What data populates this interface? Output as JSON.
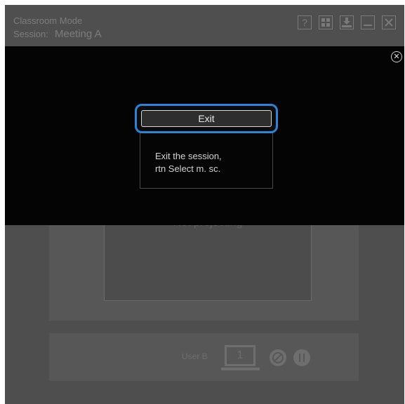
{
  "titlebar": {
    "mode": "Classroom Mode",
    "session_label": "Session:",
    "session_name": "Meeting A",
    "buttons": {
      "help": "?",
      "layout": "grid-icon",
      "save": "download-icon",
      "minimize": "minimize-icon",
      "close": "close-icon"
    }
  },
  "background": {
    "projection_status": "Not projecting",
    "user_label": "User B",
    "monitor_number": "1"
  },
  "overlay": {
    "exit_label": "Exit",
    "description_line1": "Exit the session,",
    "description_line2": "rtn Select m. sc."
  },
  "colors": {
    "accent": "#2f82d8",
    "overlay_bg": "#040404",
    "app_bg": "#4e4e4e"
  }
}
